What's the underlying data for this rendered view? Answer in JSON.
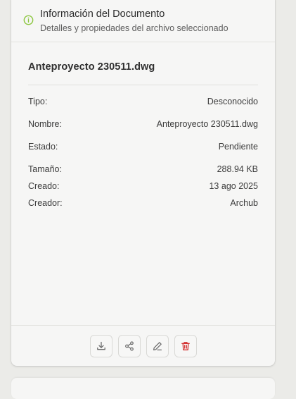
{
  "header": {
    "icon": "info-icon",
    "title": "Información del Documento",
    "subtitle": "Detalles y propiedades del archivo seleccionado",
    "accent_color": "#8cc63f"
  },
  "document": {
    "name": "Anteproyecto 230511.dwg",
    "properties": [
      {
        "label": "Tipo:",
        "value": "Desconocido"
      },
      {
        "label": "Nombre:",
        "value": "Anteproyecto 230511.dwg"
      },
      {
        "label": "Estado:",
        "value": "Pendiente"
      },
      {
        "label": "Tamaño:",
        "value": "288.94 KB"
      },
      {
        "label": "Creado:",
        "value": "13 ago 2025"
      },
      {
        "label": "Creador:",
        "value": "Archub"
      }
    ]
  },
  "actions": [
    {
      "icon": "download-icon",
      "color": "#6b6b6b"
    },
    {
      "icon": "share-icon",
      "color": "#6b6b6b"
    },
    {
      "icon": "edit-icon",
      "color": "#6b6b6b"
    },
    {
      "icon": "trash-icon",
      "color": "#d32f2f"
    }
  ]
}
